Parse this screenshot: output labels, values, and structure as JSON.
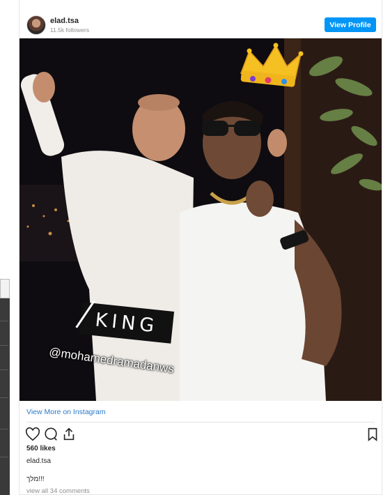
{
  "post": {
    "username": "elad.tsa",
    "followers": "11.5k followers",
    "view_profile_label": "View Profile",
    "image": {
      "sticker_text": "KING",
      "mention": "@mohamedramadanws",
      "crown_icon": "crown-emoji-icon"
    },
    "view_more_label": "View More on Instagram",
    "actions": {
      "like_icon": "heart-icon",
      "comment_icon": "comment-icon",
      "share_icon": "share-icon",
      "save_icon": "bookmark-icon"
    },
    "likes": "560 likes",
    "caption_username": "elad.tsa",
    "comment_text": "מלך!!!",
    "view_all_comments": "view all 34 comments"
  },
  "colors": {
    "accent": "#0095f6",
    "link": "#2a78c6",
    "muted": "#8e8e8e"
  }
}
